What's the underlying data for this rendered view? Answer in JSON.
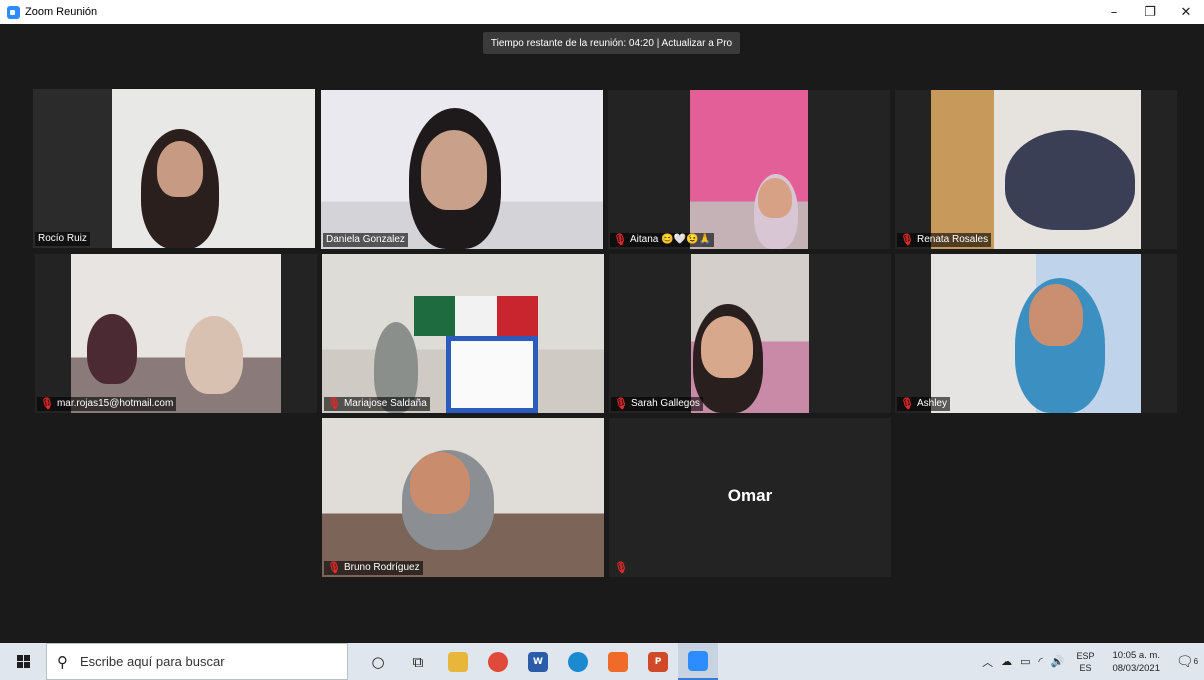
{
  "window": {
    "title": "Zoom Reunión",
    "minimize": "–",
    "restore": "❐",
    "close": "✕"
  },
  "banner": {
    "text": "Tiempo restante de la reunión: 04:20 | Actualizar a Pro"
  },
  "participants": [
    {
      "name": "Rocío Ruiz",
      "muted": false,
      "active_speaker": true
    },
    {
      "name": "Daniela Gonzalez",
      "muted": false
    },
    {
      "name": "Aitana 😊🤍😉🙏",
      "muted": true
    },
    {
      "name": "Renata Rosales",
      "muted": true
    },
    {
      "name": "mar.rojas15@hotmail.com",
      "muted": true
    },
    {
      "name": "Mariajose Saldaña",
      "muted": true
    },
    {
      "name": "Sarah Gallegos",
      "muted": true
    },
    {
      "name": "Ashley",
      "muted": true
    },
    {
      "name": "Bruno Rodríguez",
      "muted": true
    },
    {
      "name": "Omar",
      "muted": true,
      "video_off": true
    }
  ],
  "taskbar": {
    "search_placeholder": "Escribe aquí para buscar",
    "apps": [
      "cortana-icon",
      "task-view-icon",
      "file-explorer-icon",
      "chrome-icon",
      "word-icon",
      "edge-icon",
      "brave-icon",
      "powerpoint-icon",
      "zoom-icon"
    ],
    "word_label": "W",
    "ppt_label": "P",
    "tray_lang_top": "ESP",
    "tray_lang_bottom": "ES",
    "time": "10:05 a. m.",
    "date": "08/03/2021",
    "notification_count": "6"
  },
  "colors": {
    "active_speaker_border": "#c7e85b",
    "muted_icon": "#e02828",
    "background": "#1a1a1a"
  }
}
